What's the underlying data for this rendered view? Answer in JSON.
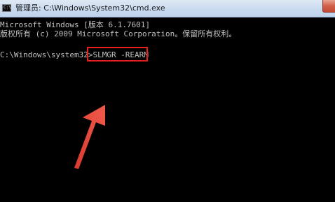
{
  "window": {
    "title": "管理员: C:\\Windows\\System32\\cmd.exe",
    "icon": "C:\\"
  },
  "console": {
    "lines": [
      "Microsoft Windows [版本 6.1.7601]",
      "版权所有 (c) 2009 Microsoft Corporation。保留所有权利。",
      "",
      "C:\\Windows\\system32>"
    ],
    "typed_command": "SLMGR -REARM"
  },
  "colors": {
    "console_bg": "#000000",
    "console_text": "#c0c0c0",
    "highlight": "#e8201c"
  }
}
